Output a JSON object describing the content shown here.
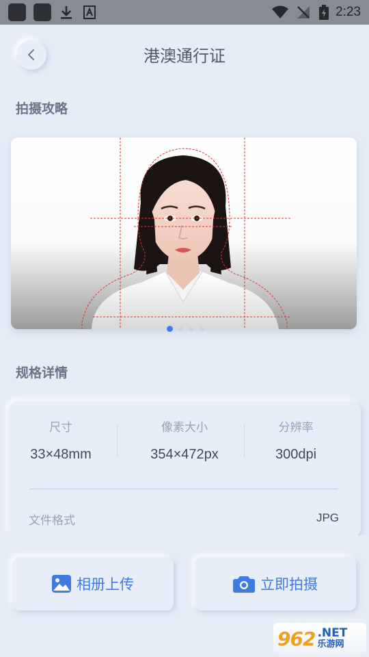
{
  "status_bar": {
    "time": "2:23"
  },
  "header": {
    "title": "港澳通行证"
  },
  "guide": {
    "section_title": "拍摄攻略",
    "active_slide": 1,
    "slide_count": 4
  },
  "specs": {
    "section_title": "规格详情",
    "size": {
      "label": "尺寸",
      "value": "33×48mm"
    },
    "pixels": {
      "label": "像素大小",
      "value": "354×472px"
    },
    "resolution": {
      "label": "分辨率",
      "value": "300dpi"
    },
    "format": {
      "label": "文件格式",
      "value": "JPG"
    }
  },
  "actions": {
    "album_label": "相册上传",
    "camera_label": "立即拍摄"
  },
  "watermark": {
    "number": "962",
    "suffix": ".NET",
    "site": "乐游网"
  },
  "colors": {
    "accent": "#3e7ae0",
    "background": "#e6edf7",
    "guide_line": "#e0342f"
  }
}
